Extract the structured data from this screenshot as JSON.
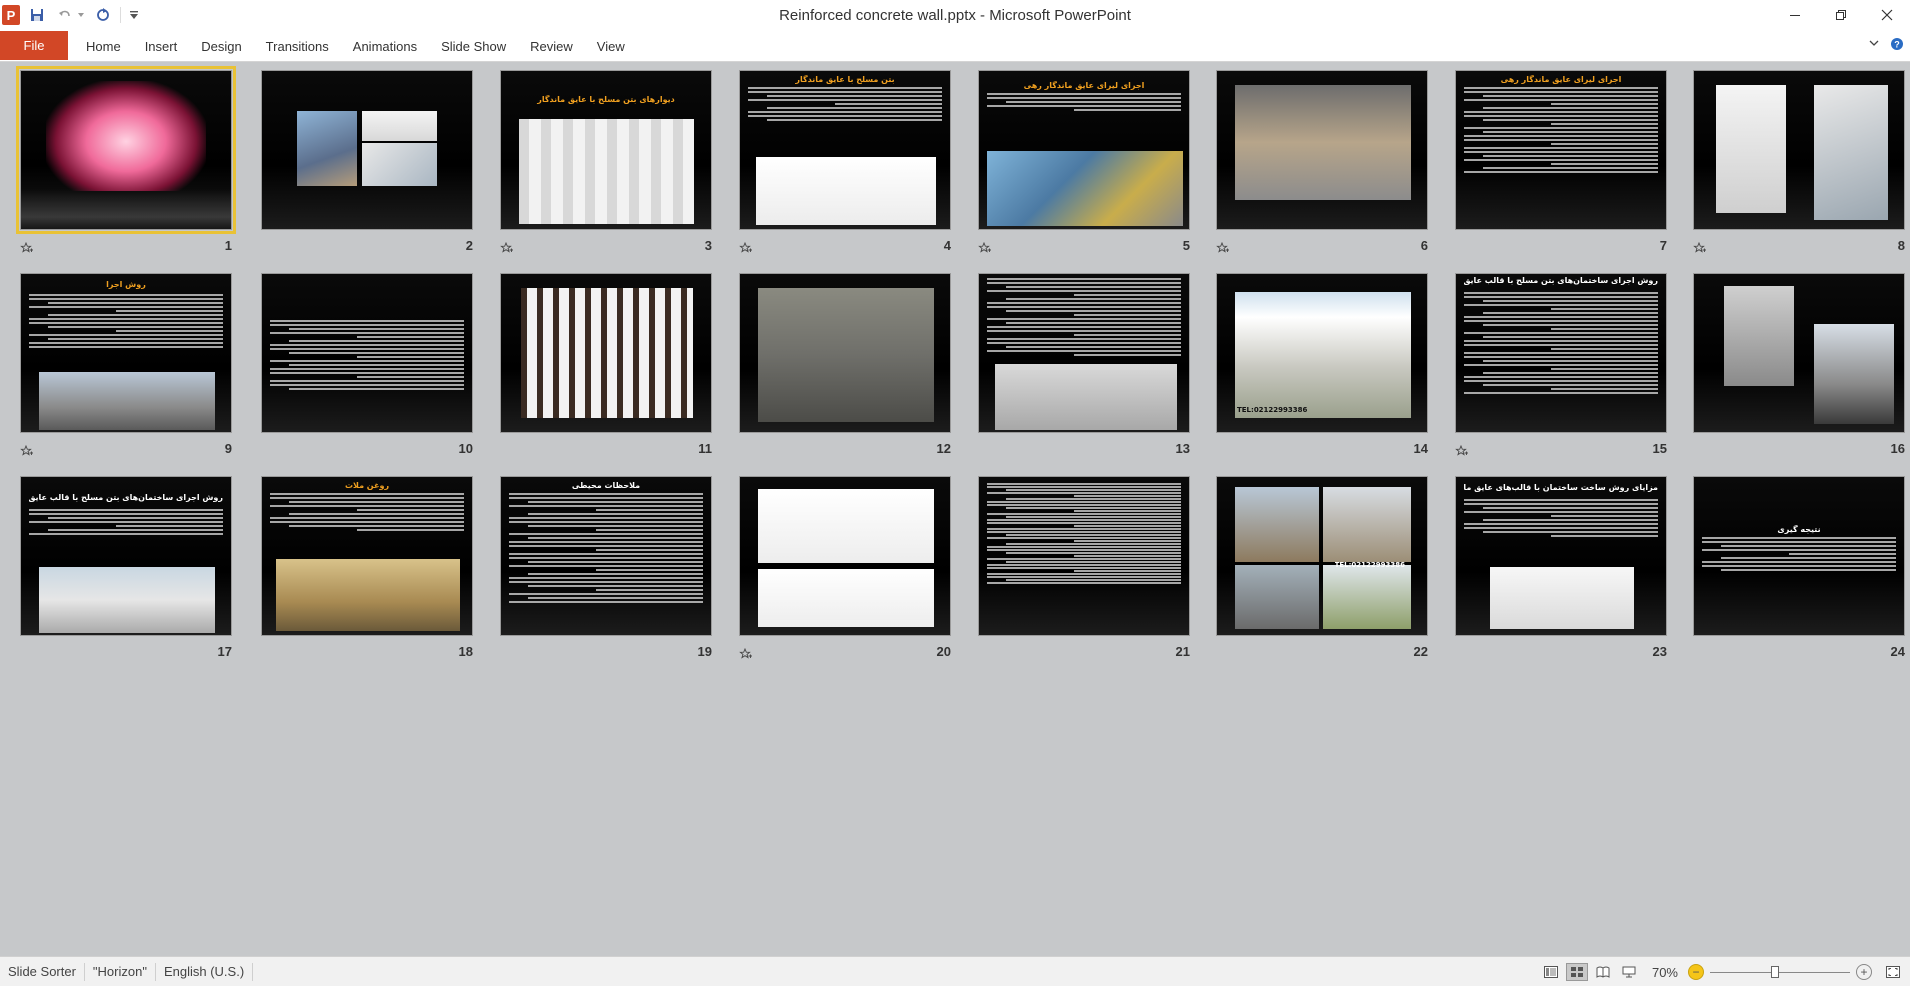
{
  "window": {
    "title": "Reinforced concrete wall.pptx  -  Microsoft PowerPoint",
    "app_icon_letter": "P"
  },
  "ribbon": {
    "file_label": "File",
    "tabs": [
      "Home",
      "Insert",
      "Design",
      "Transitions",
      "Animations",
      "Slide Show",
      "Review",
      "View"
    ]
  },
  "slides": [
    {
      "num": "1",
      "selected": true,
      "star": true
    },
    {
      "num": "2",
      "star": false
    },
    {
      "num": "3",
      "star": true
    },
    {
      "num": "4",
      "star": true
    },
    {
      "num": "5",
      "star": true
    },
    {
      "num": "6",
      "star": true
    },
    {
      "num": "7",
      "star": false
    },
    {
      "num": "8",
      "star": true
    },
    {
      "num": "9",
      "star": true
    },
    {
      "num": "10",
      "star": false
    },
    {
      "num": "11",
      "star": false
    },
    {
      "num": "12",
      "star": false
    },
    {
      "num": "13",
      "star": false
    },
    {
      "num": "14",
      "star": false
    },
    {
      "num": "15",
      "star": true
    },
    {
      "num": "16",
      "star": false
    },
    {
      "num": "17",
      "star": false
    },
    {
      "num": "18",
      "star": false
    },
    {
      "num": "19",
      "star": false
    },
    {
      "num": "20",
      "star": true
    },
    {
      "num": "21",
      "star": false
    },
    {
      "num": "22",
      "star": false
    },
    {
      "num": "23",
      "star": false
    },
    {
      "num": "24",
      "star": false
    }
  ],
  "slide_text": {
    "s3_title": "دیوارهای بتن مسلح با عایق ماندگار",
    "s4_title": "بتن مسلح با عایق ماندگار",
    "s5_title": "اجرای لیرای عایق ماندگار رهی",
    "s7_title": "اجرای لیرای عایق ماندگار رهی",
    "s9_title": "روش اجرا",
    "s15_title": "روش اجرای ساختمان‌های بتن مسلح با قالب عایق ماندگار مسلح عمومی",
    "s17_title": "روش اجرای ساختمان‌های بتن مسلح با قالب عایق ماندگار مسلح و پلیتی",
    "s18_title": "روغن ملات",
    "s19_title": "ملاحظات محیطی",
    "s23_title": "مزایای روش ساخت ساختمان با قالب‌های عایق ماندگار",
    "s24_title": "نتیجه گیری",
    "s14_phone": "TEL:02122993386",
    "s22_phone": "TEL:02122993386"
  },
  "status": {
    "slide_sorter": "Slide Sorter",
    "theme": "\"Horizon\"",
    "language": "English (U.S.)",
    "zoom": "70%",
    "zoom_fraction": 0.7
  },
  "colors": {
    "file_tab": "#d24726",
    "selection": "#e9c235",
    "slide_bg": "#040404",
    "sorter_bg": "#c6c8ca"
  }
}
